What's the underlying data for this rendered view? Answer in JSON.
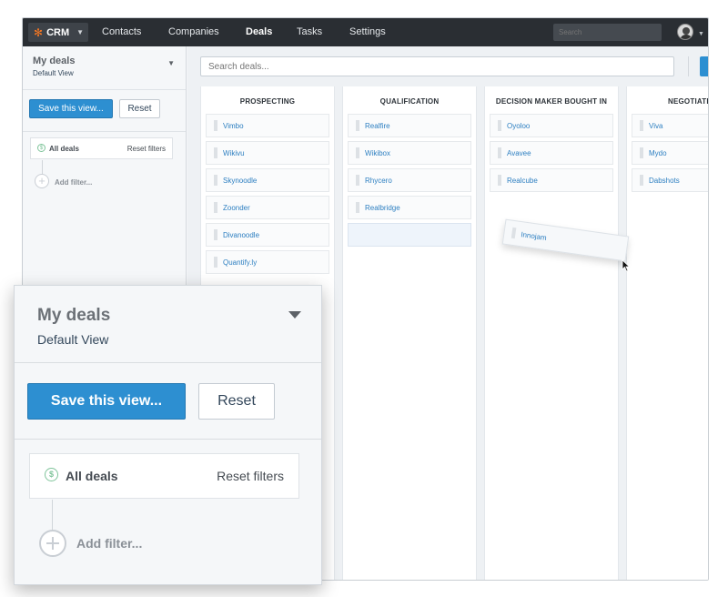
{
  "nav": {
    "logo_label": "CRM",
    "items": [
      "Contacts",
      "Companies",
      "Deals",
      "Tasks",
      "Settings"
    ],
    "active": "Deals",
    "search_placeholder": "Search"
  },
  "sidebar": {
    "title": "My deals",
    "subtitle": "Default View",
    "save_label": "Save this view...",
    "reset_label": "Reset",
    "filter_label": "All deals",
    "reset_filters_label": "Reset filters",
    "add_filter_label": "Add filter..."
  },
  "main": {
    "search_placeholder": "Search deals...",
    "columns": [
      {
        "title": "PROSPECTING",
        "cards": [
          "Vimbo",
          "Wikivu",
          "Skynoodle",
          "Zoonder",
          "Divanoodle",
          "Quantify.ly"
        ]
      },
      {
        "title": "QUALIFICATION",
        "cards": [
          "Realfire",
          "Wikibox",
          "Rhycero",
          "Realbridge"
        ]
      },
      {
        "title": "DECISION MAKER BOUGHT IN",
        "cards": [
          "Oyoloo",
          "Avavee",
          "Realcube"
        ]
      },
      {
        "title": "NEGOTIATIO",
        "cards": [
          "Viva",
          "Mydo",
          "Dabshots"
        ]
      }
    ],
    "dragging_card": "Innojam"
  },
  "colors": {
    "nav_bg": "#2a2e33",
    "primary": "#2d8fd1",
    "link": "#2d7fc1",
    "accent": "#f47622"
  }
}
